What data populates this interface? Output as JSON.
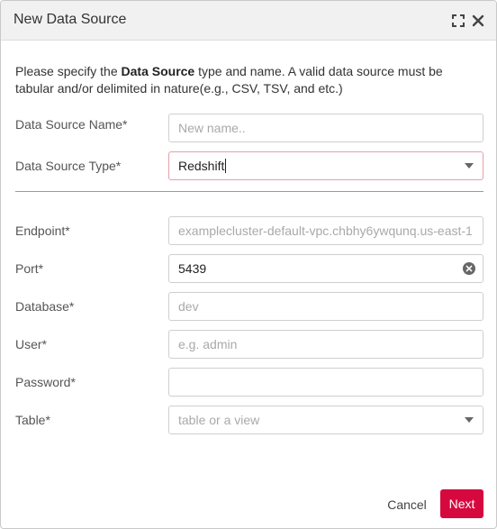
{
  "dialog": {
    "title": "New Data Source",
    "maximize_icon": "maximize-icon",
    "close_icon": "close-icon"
  },
  "intro": {
    "prefix": "Please specify the ",
    "bold": "Data Source",
    "suffix": " type and name. A valid data source must be tabular and/or delimited in nature(e.g., CSV, TSV, and etc.)"
  },
  "fields": {
    "name": {
      "label": "Data Source Name*",
      "placeholder": "New name..",
      "value": ""
    },
    "type": {
      "label": "Data Source Type*",
      "value": "Redshift"
    },
    "endpoint": {
      "label": "Endpoint*",
      "placeholder": "examplecluster-default-vpc.chbhy6ywqunq.us-east-1",
      "value": ""
    },
    "port": {
      "label": "Port*",
      "value": "5439"
    },
    "database": {
      "label": "Database*",
      "placeholder": "dev",
      "value": ""
    },
    "user": {
      "label": "User*",
      "placeholder": "e.g. admin",
      "value": ""
    },
    "password": {
      "label": "Password*",
      "value": ""
    },
    "table": {
      "label": "Table*",
      "placeholder": "table or a view"
    }
  },
  "buttons": {
    "cancel": "Cancel",
    "next": "Next"
  },
  "colors": {
    "accent": "#d6093f",
    "focus_border": "#e6a0ab",
    "titlebar": "#f1f1f1"
  }
}
